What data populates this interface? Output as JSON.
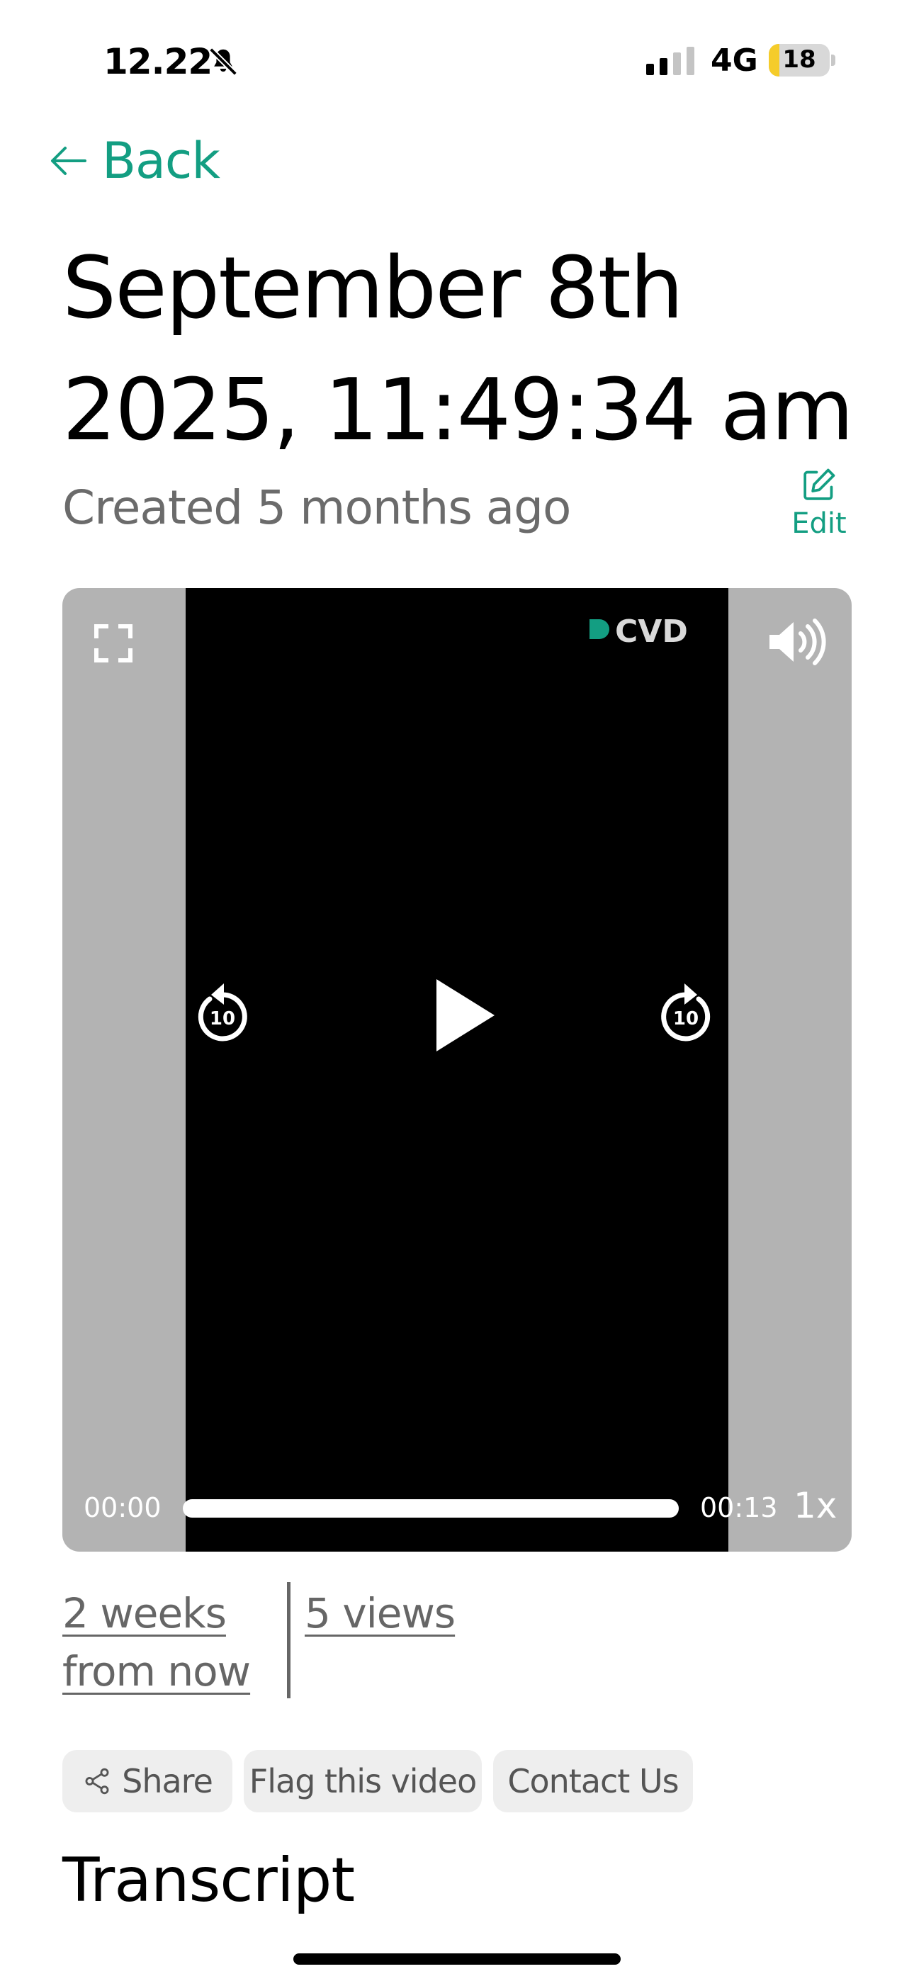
{
  "status_bar": {
    "time": "12.22",
    "network": "4G",
    "battery_level": "18",
    "battery_fraction": 0.18,
    "icons": [
      "bell-slash-icon",
      "signal-icon"
    ]
  },
  "nav": {
    "back_label": "Back",
    "back_icon": "arrow-left-icon"
  },
  "header": {
    "title": "September 8th 2025, 11:49:34 am",
    "created": "Created 5 months ago",
    "edit_label": "Edit",
    "edit_icon": "pencil-square-icon"
  },
  "player": {
    "logo_text": "CVD",
    "current_time": "00:00",
    "total_time": "00:13",
    "speed": "1x",
    "progress_fraction": 0.0,
    "skip_back_seconds": "10",
    "skip_forward_seconds": "10",
    "icons": [
      "fullscreen-icon",
      "volume-icon",
      "rewind-10-icon",
      "play-icon",
      "forward-10-icon"
    ]
  },
  "meta": {
    "expiry": "2 weeks from now",
    "views": "5 views"
  },
  "actions": {
    "share": "Share",
    "flag": "Flag this video",
    "contact": "Contact Us"
  },
  "transcript": {
    "heading": "Transcript"
  },
  "colors": {
    "accent": "#139e82",
    "player_bg": "#b3b3b3",
    "muted_text": "#6b6b6b",
    "pill_bg": "#eeeeee"
  }
}
